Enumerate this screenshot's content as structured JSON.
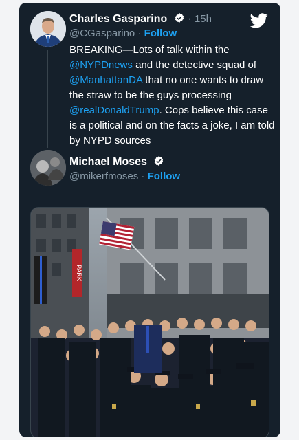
{
  "tweet1": {
    "name": "Charles Gasparino",
    "handle": "@CGasparino",
    "time": "15h",
    "follow": "Follow",
    "separator": "·",
    "text": {
      "p1": "BREAKING—Lots of talk within the ",
      "m1": "@NYPDnews",
      "p2": " and the detective squad of ",
      "m2": "@ManhattanDA",
      "p3": " that no one wants to draw the straw to be the guys processing ",
      "m3": "@realDonaldTrump",
      "p4": ". Cops believe this case is a political and on the facts a joke, I am told by NYPD sources"
    }
  },
  "tweet2": {
    "name": "Michael Moses",
    "handle": "@mikerfmoses",
    "follow": "Follow",
    "separator": "·"
  },
  "photo": {
    "sign_text": "PARK"
  },
  "colors": {
    "background": "#15202b",
    "link": "#1da1f2",
    "secondary": "#8899a6"
  },
  "icons": [
    "twitter-bird-icon",
    "verified-badge-icon"
  ]
}
